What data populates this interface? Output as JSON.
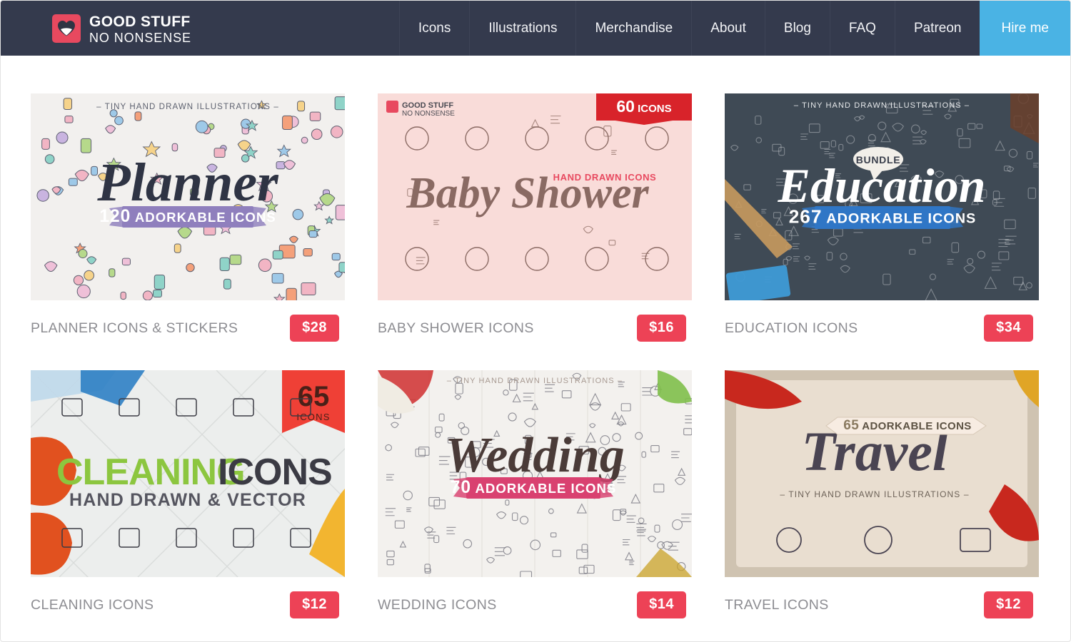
{
  "site": {
    "brand_top": "GOOD STUFF",
    "brand_bottom": "NO NONSENSE",
    "logo_icon": "heart-smile-icon"
  },
  "nav": {
    "items": [
      {
        "label": "Icons",
        "name": "nav-item-icons",
        "cta": false
      },
      {
        "label": "Illustrations",
        "name": "nav-item-illustrations",
        "cta": false
      },
      {
        "label": "Merchandise",
        "name": "nav-item-merchandise",
        "cta": false
      },
      {
        "label": "About",
        "name": "nav-item-about",
        "cta": false
      },
      {
        "label": "Blog",
        "name": "nav-item-blog",
        "cta": false
      },
      {
        "label": "FAQ",
        "name": "nav-item-faq",
        "cta": false
      },
      {
        "label": "Patreon",
        "name": "nav-item-patreon",
        "cta": false
      },
      {
        "label": "Hire me",
        "name": "nav-item-hire-me",
        "cta": true
      }
    ]
  },
  "colors": {
    "header_bg": "#343a4d",
    "cta_blue": "#4ab3e4",
    "price_red": "#ed4256",
    "logo_red": "#e8495f",
    "title_gray": "#8d8d92"
  },
  "products": [
    {
      "title": "PLANNER ICONS & STICKERS",
      "price": "$28",
      "art": {
        "kicker": "TINY HAND DRAWN  ILLUSTRATIONS",
        "script": "Planner",
        "ribbon_count": "120",
        "ribbon_text": "ADORKABLE ICONS",
        "badge": "",
        "bg": "#f2f0ee",
        "ribbon_color": "#8f7fbd",
        "script_color": "#2f3444"
      }
    },
    {
      "title": "BABY SHOWER ICONS",
      "price": "$16",
      "art": {
        "kicker": "HAND DRAWN ICONS",
        "script": "Baby Shower",
        "ribbon_count": "",
        "ribbon_text": "",
        "badge": "60",
        "badge_label": "ICONS",
        "logo_top": "GOOD STUFF",
        "logo_bottom": "NO NONSENSE",
        "bg": "#f9dcd9",
        "ribbon_color": "#e8495f",
        "script_color": "#8a6a63"
      }
    },
    {
      "title": "EDUCATION ICONS",
      "price": "$34",
      "art": {
        "kicker": "TINY HAND DRAWN  ILLUSTRATIONS",
        "script": "Education",
        "ribbon_count": "267",
        "ribbon_text": "ADORKABLE ICONS",
        "badge": "BUNDLE",
        "bg": "#3f4a55",
        "ribbon_color": "#2f76c6",
        "script_color": "#ffffff"
      }
    },
    {
      "title": "CLEANING ICONS",
      "price": "$12",
      "art": {
        "kicker": "",
        "script": "CLEANING",
        "script2": "ICONS",
        "subtitle": "HAND DRAWN & VECTOR",
        "ribbon_count": "",
        "ribbon_text": "",
        "badge": "65",
        "badge_label": "ICONS",
        "bg": "#eceeed",
        "ribbon_color": "#ef4036",
        "script_color": "#8cc63f"
      }
    },
    {
      "title": "WEDDING ICONS",
      "price": "$14",
      "art": {
        "kicker": "TINY HAND DRAWN  ILLUSTRATIONS",
        "script": "Wedding",
        "ribbon_count": "70",
        "ribbon_text": "ADORKABLE ICONS",
        "badge": "",
        "bg": "#f3f1ee",
        "ribbon_color": "#d94170",
        "script_color": "#4a3b38"
      }
    },
    {
      "title": "TRAVEL ICONS",
      "price": "$12",
      "art": {
        "kicker": "TINY HAND DRAWN  ILLUSTRATIONS",
        "script": "Travel",
        "ribbon_count": "65",
        "ribbon_text": "ADORKABLE ICONS",
        "badge": "",
        "bg": "#e8d9c9",
        "ribbon_color": "#f7ece2",
        "script_color": "#4a4452"
      }
    }
  ]
}
